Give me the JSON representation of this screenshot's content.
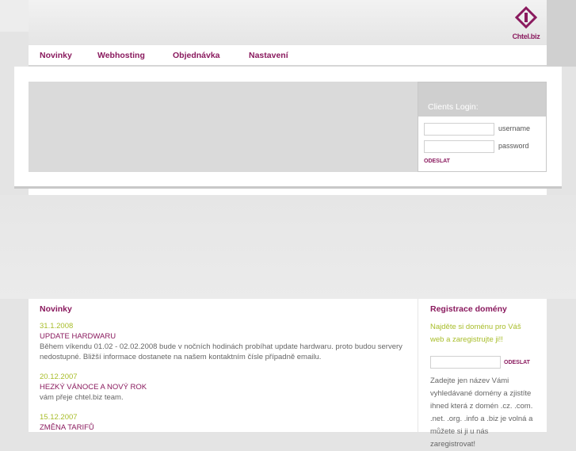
{
  "logo": {
    "text": "Chtel.biz"
  },
  "nav": [
    {
      "label": "Novinky"
    },
    {
      "label": "Webhosting"
    },
    {
      "label": "Objednávka"
    },
    {
      "label": "Nastavení"
    }
  ],
  "login": {
    "title": "Clients Login:",
    "username_label": "username",
    "password_label": "password",
    "username_value": "",
    "password_value": "",
    "submit": "ODESLAT"
  },
  "news": {
    "heading": "Novinky",
    "items": [
      {
        "date": "31.1.2008",
        "title": "UPDATE HARDWARU",
        "body": "Během víkendu 01.02 - 02.02.2008 bude v nočních hodinách probíhat update hardwaru. proto budou servery nedostupné. Bližší informace dostanete na našem kontaktním čísle případně emailu."
      },
      {
        "date": "20.12.2007",
        "title": "HEZKÝ VÁNOCE A NOVÝ ROK",
        "body": "vám přeje chtel.biz team."
      },
      {
        "date": "15.12.2007",
        "title": "ZMĚNA TARIFŮ",
        "body": ""
      }
    ]
  },
  "registration": {
    "heading": "Registrace domény",
    "tagline": "Najděte si doménu pro Váš web a zaregistrujte ji!!",
    "domain_value": "",
    "submit": "ODESLAT",
    "text": "Zadejte jen název Vámi vyhledávané domény a zjistíte ihned která z domén .cz. .com. .net. .org. .info a .biz je volná a můžete si ji u nás zaregistrovat!"
  }
}
